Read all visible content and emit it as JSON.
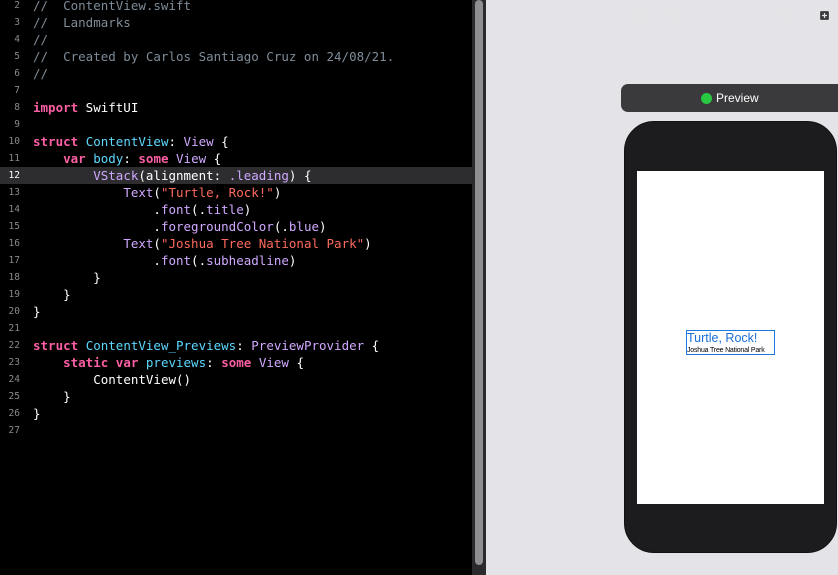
{
  "editor": {
    "current_line": "12",
    "lines": [
      {
        "n": "2",
        "tokens": [
          {
            "t": "//  ContentView.swift",
            "c": "c-comment"
          }
        ]
      },
      {
        "n": "3",
        "tokens": [
          {
            "t": "//  Landmarks",
            "c": "c-comment"
          }
        ]
      },
      {
        "n": "4",
        "tokens": [
          {
            "t": "//",
            "c": "c-comment"
          }
        ]
      },
      {
        "n": "5",
        "tokens": [
          {
            "t": "//  Created by Carlos Santiago Cruz on 24/08/21.",
            "c": "c-comment"
          }
        ]
      },
      {
        "n": "6",
        "tokens": [
          {
            "t": "//",
            "c": "c-comment"
          }
        ]
      },
      {
        "n": "7",
        "tokens": []
      },
      {
        "n": "8",
        "tokens": [
          {
            "t": "import",
            "c": "c-kw"
          },
          {
            "t": " SwiftUI",
            "c": "c-plain"
          }
        ]
      },
      {
        "n": "9",
        "tokens": []
      },
      {
        "n": "10",
        "tokens": [
          {
            "t": "struct",
            "c": "c-kw"
          },
          {
            "t": " ",
            "c": "c-plain"
          },
          {
            "t": "ContentView",
            "c": "c-type"
          },
          {
            "t": ": ",
            "c": "c-plain"
          },
          {
            "t": "View",
            "c": "c-sys"
          },
          {
            "t": " {",
            "c": "c-plain"
          }
        ]
      },
      {
        "n": "11",
        "tokens": [
          {
            "t": "    ",
            "c": "c-plain"
          },
          {
            "t": "var",
            "c": "c-kw"
          },
          {
            "t": " ",
            "c": "c-plain"
          },
          {
            "t": "body",
            "c": "c-type"
          },
          {
            "t": ": ",
            "c": "c-plain"
          },
          {
            "t": "some",
            "c": "c-kw"
          },
          {
            "t": " ",
            "c": "c-plain"
          },
          {
            "t": "View",
            "c": "c-sys"
          },
          {
            "t": " {",
            "c": "c-plain"
          }
        ]
      },
      {
        "n": "12",
        "tokens": [
          {
            "t": "        ",
            "c": "c-plain"
          },
          {
            "t": "VStack",
            "c": "c-sys"
          },
          {
            "t": "(alignment: ",
            "c": "c-plain"
          },
          {
            "t": ".leading",
            "c": "c-sys"
          },
          {
            "t": ") {",
            "c": "c-plain"
          }
        ]
      },
      {
        "n": "13",
        "tokens": [
          {
            "t": "            ",
            "c": "c-plain"
          },
          {
            "t": "Text",
            "c": "c-sys"
          },
          {
            "t": "(",
            "c": "c-plain"
          },
          {
            "t": "\"Turtle, Rock!\"",
            "c": "c-str"
          },
          {
            "t": ")",
            "c": "c-plain"
          }
        ]
      },
      {
        "n": "14",
        "tokens": [
          {
            "t": "                .",
            "c": "c-plain"
          },
          {
            "t": "font",
            "c": "c-sys"
          },
          {
            "t": "(.",
            "c": "c-plain"
          },
          {
            "t": "title",
            "c": "c-sys"
          },
          {
            "t": ")",
            "c": "c-plain"
          }
        ]
      },
      {
        "n": "15",
        "tokens": [
          {
            "t": "                .",
            "c": "c-plain"
          },
          {
            "t": "foregroundColor",
            "c": "c-sys"
          },
          {
            "t": "(.",
            "c": "c-plain"
          },
          {
            "t": "blue",
            "c": "c-sys"
          },
          {
            "t": ")",
            "c": "c-plain"
          }
        ]
      },
      {
        "n": "16",
        "tokens": [
          {
            "t": "            ",
            "c": "c-plain"
          },
          {
            "t": "Text",
            "c": "c-sys"
          },
          {
            "t": "(",
            "c": "c-plain"
          },
          {
            "t": "\"Joshua Tree National Park\"",
            "c": "c-str"
          },
          {
            "t": ")",
            "c": "c-plain"
          }
        ]
      },
      {
        "n": "17",
        "tokens": [
          {
            "t": "                .",
            "c": "c-plain"
          },
          {
            "t": "font",
            "c": "c-sys"
          },
          {
            "t": "(.",
            "c": "c-plain"
          },
          {
            "t": "subheadline",
            "c": "c-sys"
          },
          {
            "t": ")",
            "c": "c-plain"
          }
        ]
      },
      {
        "n": "18",
        "tokens": [
          {
            "t": "        }",
            "c": "c-plain"
          }
        ]
      },
      {
        "n": "19",
        "tokens": [
          {
            "t": "    }",
            "c": "c-plain"
          }
        ]
      },
      {
        "n": "20",
        "tokens": [
          {
            "t": "}",
            "c": "c-plain"
          }
        ]
      },
      {
        "n": "21",
        "tokens": []
      },
      {
        "n": "22",
        "tokens": [
          {
            "t": "struct",
            "c": "c-kw"
          },
          {
            "t": " ",
            "c": "c-plain"
          },
          {
            "t": "ContentView_Previews",
            "c": "c-type"
          },
          {
            "t": ": ",
            "c": "c-plain"
          },
          {
            "t": "PreviewProvider",
            "c": "c-sys"
          },
          {
            "t": " {",
            "c": "c-plain"
          }
        ]
      },
      {
        "n": "23",
        "tokens": [
          {
            "t": "    ",
            "c": "c-plain"
          },
          {
            "t": "static",
            "c": "c-kw"
          },
          {
            "t": " ",
            "c": "c-plain"
          },
          {
            "t": "var",
            "c": "c-kw"
          },
          {
            "t": " ",
            "c": "c-plain"
          },
          {
            "t": "previews",
            "c": "c-type"
          },
          {
            "t": ": ",
            "c": "c-plain"
          },
          {
            "t": "some",
            "c": "c-kw"
          },
          {
            "t": " ",
            "c": "c-plain"
          },
          {
            "t": "View",
            "c": "c-sys"
          },
          {
            "t": " {",
            "c": "c-plain"
          }
        ]
      },
      {
        "n": "24",
        "tokens": [
          {
            "t": "        ",
            "c": "c-plain"
          },
          {
            "t": "ContentView",
            "c": "c-plain"
          },
          {
            "t": "()",
            "c": "c-plain"
          }
        ]
      },
      {
        "n": "25",
        "tokens": [
          {
            "t": "    }",
            "c": "c-plain"
          }
        ]
      },
      {
        "n": "26",
        "tokens": [
          {
            "t": "}",
            "c": "c-plain"
          }
        ]
      },
      {
        "n": "27",
        "tokens": []
      }
    ]
  },
  "preview_toolbar": {
    "live_icon": "play-circle-icon",
    "device_icon": "device-settings-icon",
    "status_color": "#28c840",
    "preview_label": "Preview",
    "screen_icon": "display-icon",
    "duplicate_icon": "duplicate-preview-icon"
  },
  "preview_screen": {
    "title": "Turtle, Rock!",
    "title_color": "#1a6fd6",
    "subtitle": "Joshua Tree National Park",
    "selection_color": "#1b7ae0"
  },
  "colors": {
    "keyword": "#fc5fa3",
    "type": "#5dd8ff",
    "system": "#d0a8ff",
    "string": "#fc6a5d",
    "comment": "#7f8c98"
  }
}
